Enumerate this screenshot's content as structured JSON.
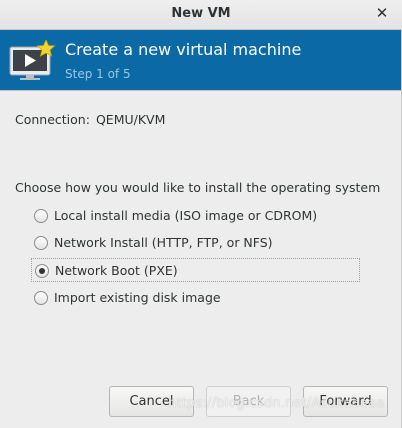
{
  "window": {
    "title": "New VM",
    "close_glyph": "✕"
  },
  "banner": {
    "heading": "Create a new virtual machine",
    "step": "Step 1 of 5",
    "icon": "vm-monitor-star-icon",
    "bg_color": "#0b6aa5"
  },
  "connection": {
    "label": "Connection:",
    "value": "QEMU/KVM"
  },
  "install": {
    "prompt": "Choose how you would like to install the operating system",
    "options": [
      {
        "label": "Local install media (ISO image or CDROM)",
        "selected": false
      },
      {
        "label": "Network Install (HTTP, FTP, or NFS)",
        "selected": false
      },
      {
        "label": "Network Boot (PXE)",
        "selected": true
      },
      {
        "label": "Import existing disk image",
        "selected": false
      }
    ]
  },
  "buttons": {
    "cancel": "Cancel",
    "back": "Back",
    "forward": "Forward"
  },
  "watermark": "https://blog.csdn.net/Asukaaaaa"
}
